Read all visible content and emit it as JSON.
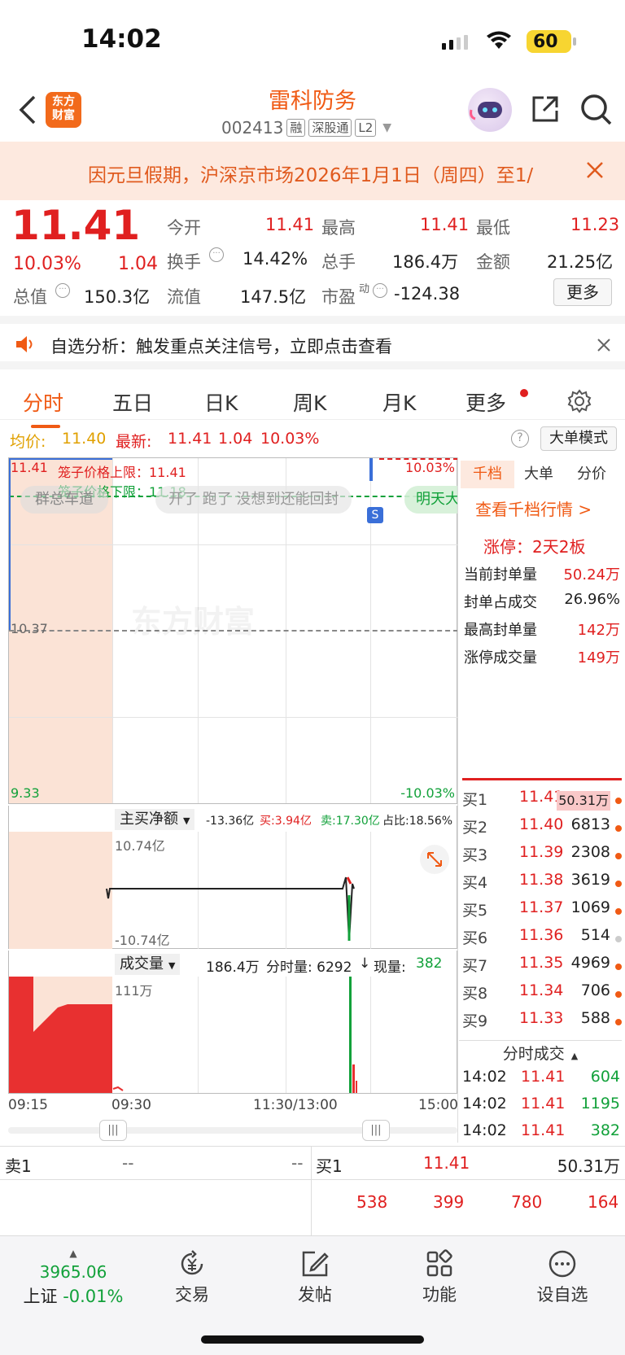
{
  "status_bar": {
    "time": "14:02",
    "battery": "60"
  },
  "header": {
    "title": "雷科防务",
    "code": "002413",
    "tags": [
      "融",
      "深股通",
      "L2"
    ]
  },
  "logo": {
    "line1": "东方",
    "line2": "财富"
  },
  "banner": {
    "text": "因元旦假期，沪深京市场2026年1月1日（周四）至1/"
  },
  "quote": {
    "price": "11.41",
    "change_pct": "10.03%",
    "change": "1.04",
    "fields": [
      {
        "label": "今开",
        "value": "11.41",
        "color": "red"
      },
      {
        "label": "最高",
        "value": "11.41",
        "color": "red"
      },
      {
        "label": "最低",
        "value": "11.23",
        "color": "red"
      },
      {
        "label": "换手",
        "value": "14.42%",
        "color": "dark"
      },
      {
        "label": "总手",
        "value": "186.4万",
        "color": "dark"
      },
      {
        "label": "金额",
        "value": "21.25亿",
        "color": "dark"
      },
      {
        "label": "总值",
        "value": "150.3亿",
        "color": "dark"
      },
      {
        "label": "流值",
        "value": "147.5亿",
        "color": "dark"
      },
      {
        "label": "市盈",
        "sup": "动",
        "value": "-124.38",
        "color": "dark"
      }
    ],
    "more_label": "更多"
  },
  "alert": {
    "text": "自选分析：触发重点关注信号，立即点击查看"
  },
  "tabs": [
    "分时",
    "五日",
    "日K",
    "周K",
    "月K",
    "更多"
  ],
  "sub_bar": {
    "avg_label": "均价:",
    "avg": "11.40",
    "latest_label": "最新:",
    "latest": "11.41",
    "chg": "1.04",
    "pct": "10.03%",
    "mode_label": "大单模式"
  },
  "chart": {
    "top_left": "11.41",
    "top_right": "10.03%",
    "mid": "10.37",
    "bottom_left": "9.33",
    "bottom_right": "-10.03%",
    "cage_upper": "笼子价格上限：11.41",
    "cage_lower": "笼子价格下限：11.18",
    "bubbles": [
      "群总车道",
      "开了 跑了 没想到还能回封",
      "明天大"
    ],
    "s_marker": "S",
    "watermark": "东方财富",
    "net_label": "主买净额",
    "net_total": "-13.36亿",
    "net_buy": "买:3.94亿",
    "net_sell": "卖:17.30亿",
    "net_ratio": "占比:18.56%",
    "net_top": "10.74亿",
    "net_bottom": "-10.74亿",
    "vol_label": "成交量",
    "vol_total": "186.4万",
    "vol_min": "分时量: 6292",
    "vol_now_label": "现量:",
    "vol_now": "382",
    "vol_max": "111万",
    "times": [
      "09:15",
      "09:30",
      "11:30/13:00",
      "15:00"
    ]
  },
  "panel": {
    "tabs": [
      "千档",
      "大单",
      "分价"
    ],
    "link": "查看千档行情 >",
    "limit_up": "涨停：2天2板",
    "stats": [
      {
        "label": "当前封单量",
        "value": "50.24万"
      },
      {
        "label": "封单占成交",
        "value": "26.96%"
      },
      {
        "label": "最高封单量",
        "value": "142万"
      },
      {
        "label": "涨停成交量",
        "value": "149万"
      }
    ],
    "bids": [
      {
        "label": "买1",
        "price": "11.41",
        "vol": "50.31万"
      },
      {
        "label": "买2",
        "price": "11.40",
        "vol": "6813"
      },
      {
        "label": "买3",
        "price": "11.39",
        "vol": "2308"
      },
      {
        "label": "买4",
        "price": "11.38",
        "vol": "3619"
      },
      {
        "label": "买5",
        "price": "11.37",
        "vol": "1069"
      },
      {
        "label": "买6",
        "price": "11.36",
        "vol": "514"
      },
      {
        "label": "买7",
        "price": "11.35",
        "vol": "4969"
      },
      {
        "label": "买8",
        "price": "11.34",
        "vol": "706"
      },
      {
        "label": "买9",
        "price": "11.33",
        "vol": "588"
      }
    ],
    "trades_title": "分时成交",
    "trades": [
      {
        "time": "14:02",
        "price": "11.41",
        "vol": "604"
      },
      {
        "time": "14:02",
        "price": "11.41",
        "vol": "1195"
      },
      {
        "time": "14:02",
        "price": "11.41",
        "vol": "382"
      }
    ]
  },
  "order_bar": {
    "sell_label": "卖1",
    "sell_price": "--",
    "sell_vol": "--",
    "buy_label": "买1",
    "buy_price": "11.41",
    "buy_vol": "50.31万",
    "queue": [
      "538",
      "399",
      "780",
      "164"
    ]
  },
  "bottom_nav": {
    "index_value": "3965.06",
    "index_name": "上证",
    "index_pct": "-0.01%",
    "items": [
      {
        "label": "交易",
        "icon": "yen-icon"
      },
      {
        "label": "发帖",
        "icon": "edit-icon"
      },
      {
        "label": "功能",
        "icon": "grid-icon"
      },
      {
        "label": "设自选",
        "icon": "more-icon"
      }
    ]
  }
}
